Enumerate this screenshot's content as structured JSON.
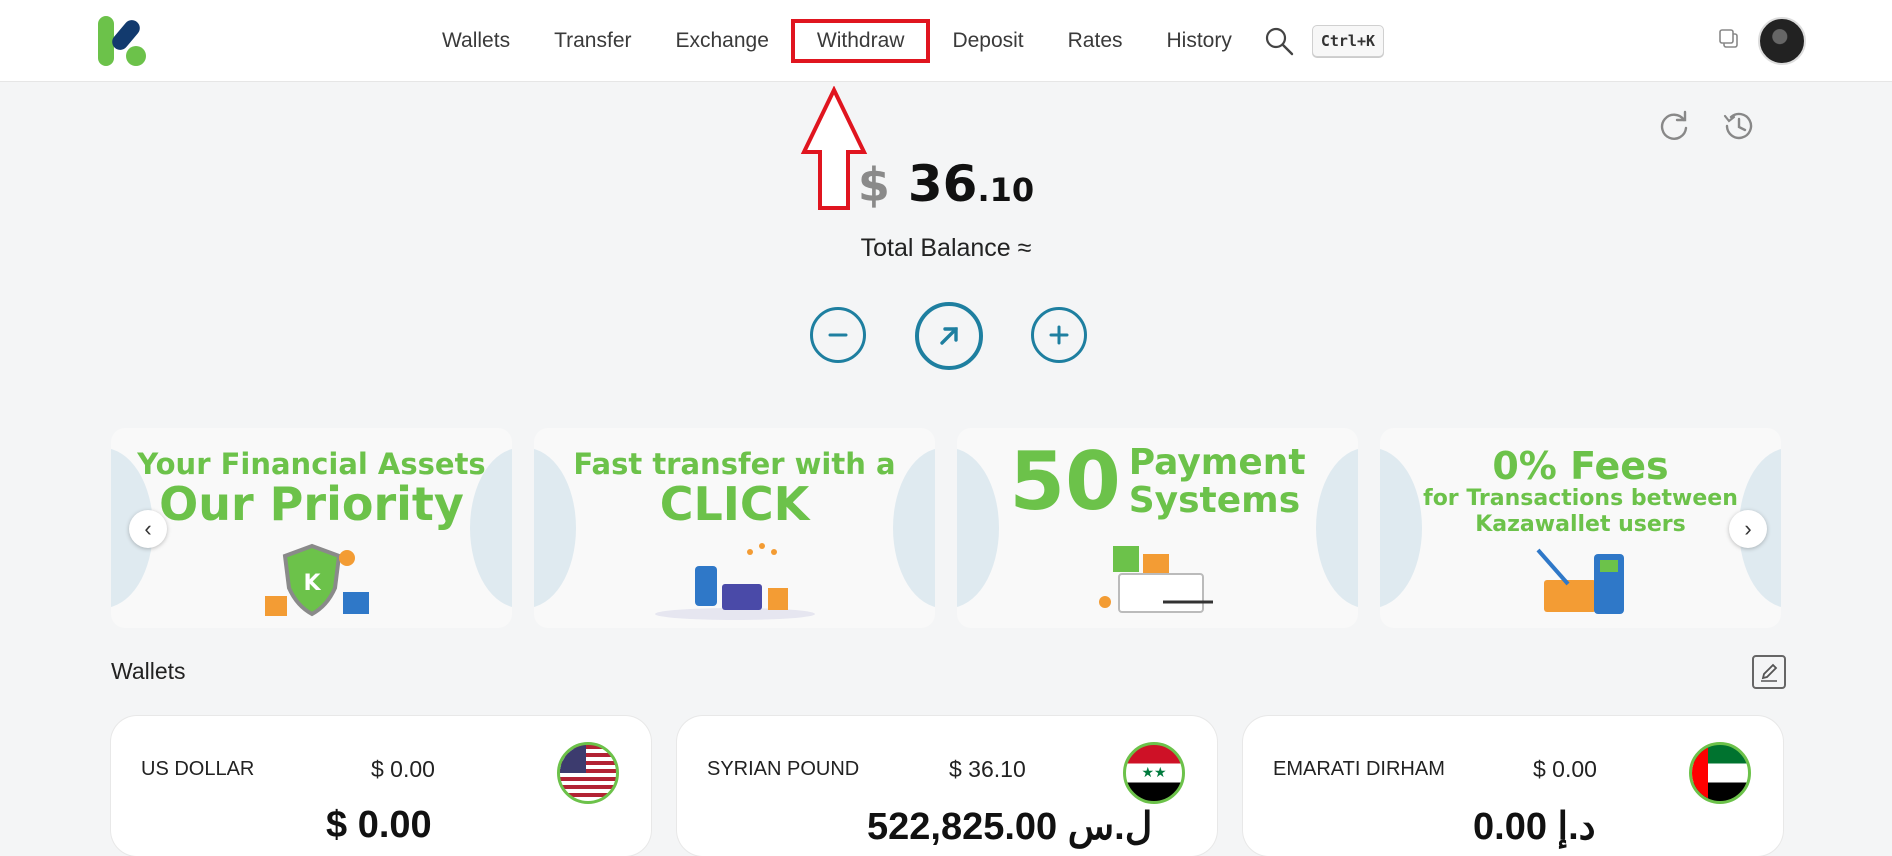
{
  "nav": {
    "items": [
      "Wallets",
      "Transfer",
      "Exchange",
      "Withdraw",
      "Deposit",
      "Rates",
      "History"
    ],
    "highlighted": "Withdraw",
    "shortcut": "Ctrl+K"
  },
  "balance": {
    "currency_symbol": "$",
    "integer": "36",
    "decimal": ".10",
    "label": "Total Balance ≈"
  },
  "banners": [
    {
      "line1": "Your Financial Assets",
      "line2": "Our Priority"
    },
    {
      "line1": "Fast transfer with a",
      "line2": "CLICK"
    },
    {
      "big": "50",
      "line1": "Payment",
      "line2": "Systems"
    },
    {
      "line1": "0% Fees",
      "line2": "for Transactions between",
      "line3": "Kazawallet users"
    }
  ],
  "wallets_section": {
    "title": "Wallets"
  },
  "wallets": [
    {
      "name": "US DOLLAR",
      "usd": "$ 0.00",
      "amount": "$ 0.00",
      "flag": "us-flag"
    },
    {
      "name": "SYRIAN POUND",
      "usd": "$ 36.10",
      "amount": "ل.س 522,825.00",
      "flag": "syria-flag"
    },
    {
      "name": "EMARATI DIRHAM",
      "usd": "$ 0.00",
      "amount": "د.إ 0.00",
      "flag": "uae-flag"
    }
  ],
  "colors": {
    "accent": "#1e7fa0",
    "brand_green": "#6cc24a",
    "highlight": "#e0151f"
  }
}
